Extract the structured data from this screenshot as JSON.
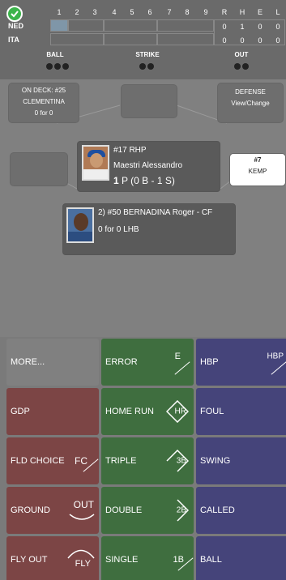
{
  "scoreboard": {
    "innings": [
      "1",
      "2",
      "3",
      "4",
      "5",
      "6",
      "7",
      "8",
      "9"
    ],
    "rhe_headers": [
      "R",
      "H",
      "E",
      "L"
    ],
    "teams": [
      {
        "name": "NED",
        "rhe": [
          "0",
          "1",
          "0",
          "0"
        ]
      },
      {
        "name": "ITA",
        "rhe": [
          "0",
          "0",
          "0",
          "0"
        ]
      }
    ],
    "count_labels": {
      "ball": "BALL",
      "strike": "STRIKE",
      "out": "OUT"
    }
  },
  "on_deck": {
    "line1": "ON DECK: #25",
    "line2": "CLEMENTINA",
    "line3": "0 for 0"
  },
  "defense": {
    "line1": "DEFENSE",
    "line2": "View/Change"
  },
  "catcher": {
    "number": "#7",
    "name": "KEMP"
  },
  "pitcher": {
    "line1": "#17 RHP",
    "line2": "Maestri Alessandro",
    "count_bold": "1",
    "count_rest": "P (0 B - 1 S)"
  },
  "batter": {
    "line1": "2) #50 BERNADINA Roger - CF",
    "line2": "0 for 0 LHB"
  },
  "buttons": {
    "more": "MORE...",
    "error": "ERROR",
    "error_tag": "E",
    "hbp": "HBP",
    "hbp_tag": "HBP",
    "gdp": "GDP",
    "home_run": "HOME RUN",
    "home_run_tag": "HR",
    "foul": "FOUL",
    "fld_choice": "FLD CHOICE",
    "fld_choice_tag": "FC",
    "triple": "TRIPLE",
    "triple_tag": "3B",
    "swing": "SWING",
    "ground": "GROUND",
    "ground_tag": "OUT",
    "double": "DOUBLE",
    "double_tag": "2B",
    "called": "CALLED",
    "fly_out": "FLY OUT",
    "fly_out_tag": "FLY",
    "single": "SINGLE",
    "single_tag": "1B",
    "ball": "BALL"
  },
  "colors": {
    "neutral": "#808080",
    "out": "#7c4545",
    "hit": "#3f6e3f",
    "pitch": "#45447a"
  }
}
